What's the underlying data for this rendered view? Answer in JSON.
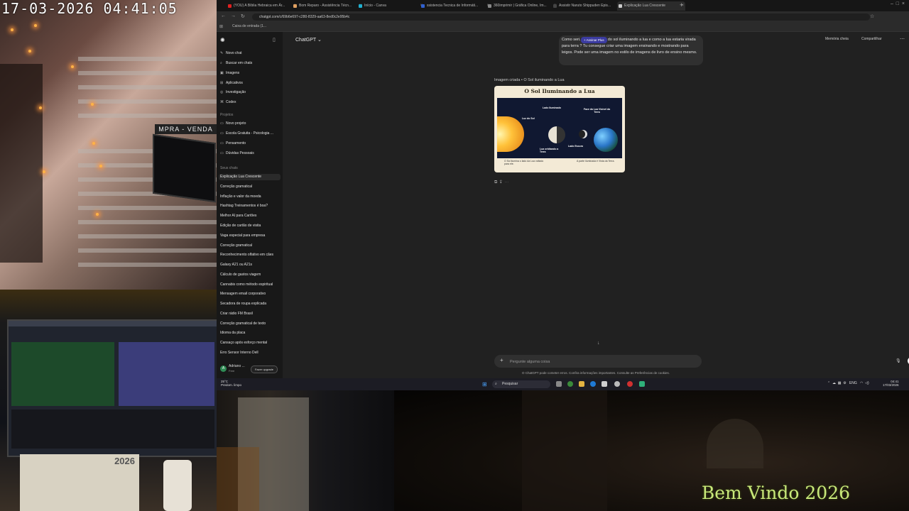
{
  "overlay": {
    "timestamp": "17-03-2026 04:41:05",
    "welcome": "Bem Vindo 2026",
    "sign_text": "MPRA - VENDA",
    "calendar_year": "2026"
  },
  "browser": {
    "tabs": [
      {
        "label": "(YOU) A Bíblia Hebraica em Ár...",
        "fav": "#e02020"
      },
      {
        "label": "Bom Reparo - Assistência Técn...",
        "fav": "#e0a060"
      },
      {
        "label": "Início - Canva",
        "fav": "#20b0d0"
      },
      {
        "label": "ssistencia Tecnica de Informáti...",
        "fav": "#3060d0"
      },
      {
        "label": "360imprimir | Gráfica Online, Im...",
        "fav": "#888888"
      },
      {
        "label": "Assistir Naruto Shippuden Epis...",
        "fav": "#444444"
      },
      {
        "label": "Explicação Lua Crescente",
        "fav": "#cccccc",
        "active": true
      }
    ],
    "url": "chatgpt.com/c/69b6e697-c280-8329-aa63-8ed0c2e95b4c",
    "bookmark": "Caixa de entrada (1..."
  },
  "sidebar": {
    "top_items": [
      {
        "label": "Novo chat",
        "icon": "compose-icon"
      },
      {
        "label": "Buscar em chats",
        "icon": "search-icon"
      },
      {
        "label": "Imagens",
        "icon": "image-icon"
      },
      {
        "label": "Aplicativos",
        "icon": "apps-icon"
      },
      {
        "label": "Investigação",
        "icon": "research-icon"
      },
      {
        "label": "Codex",
        "icon": "code-icon"
      }
    ],
    "projects_heading": "Projetos",
    "projects": [
      {
        "label": "Novo projeto"
      },
      {
        "label": "Escola Gratuita - Psicologia ..."
      },
      {
        "label": "Pensamento"
      },
      {
        "label": "Dúvidas Pessoais"
      }
    ],
    "chats_heading": "Seus chats",
    "chats": [
      "Explicação Lua Crescente",
      "Correção gramatical",
      "Inflação e valor da moeda",
      "Hashtag Treinamentos é boa?",
      "Melhor AI para Cartões",
      "Edição de cartão de visita",
      "Vaga especial para empresa",
      "Correção gramatical",
      "Reconhecimento olfativo em cães",
      "Galaxy A21 ou A21s",
      "Cálculo de gastos viagem",
      "Cannabis como método espiritual",
      "Mensagem email corporativo",
      "Secadora de roupa explicada",
      "Criar rádio FM Brasil",
      "Correção gramatical de texto",
      "Idioma da placa",
      "Cansaço após esforço mental",
      "Erro Sensor Interno Dell"
    ],
    "user_name": "Adriano ...",
    "user_plan": "Free",
    "upgrade_label": "Fazer upgrade"
  },
  "main": {
    "model_label": "ChatGPT ⌄",
    "memory_label": "Memória cheia",
    "share_label": "Compartilhar",
    "plus_badge": "+ Assinar Plus",
    "user_message": "Como seri... desse retrato do sol iluminando a lua e como a lua estaria virada para terra ? Tu consegue criar uma imagem ensinando e mostrando para leigos. Pode ser uma imagem no estilo de imagens de livro de ensino mesmo.",
    "image_caption": "Imagem criada • O Sol iluminando a Lua",
    "image": {
      "title": "O Sol Iluminando a Lua",
      "labels": {
        "sun": "Luz do Sol",
        "lit_side": "Lado Iluminado",
        "visible_face": "Face da Lua Visível da Terra",
        "orbiting": "Lua orbitando a Terra",
        "dark_side": "Lado Escuro"
      },
      "caption_left": "O Sol ilumina o lado da Lua voltado para ele.",
      "caption_right": "A parte iluminada é Vista da Terra."
    },
    "composer_placeholder": "Pergunte alguma coisa",
    "disclaimer": "O ChatGPT pode cometer erros. Confira informações importantes. Consulte as Preferências de cookies."
  },
  "taskbar": {
    "weather_temp": "25°C",
    "weather_desc": "Predom. limpo",
    "search_label": "Pesquisar",
    "language": "ENG",
    "time": "04:41",
    "date": "17/03/2026"
  }
}
